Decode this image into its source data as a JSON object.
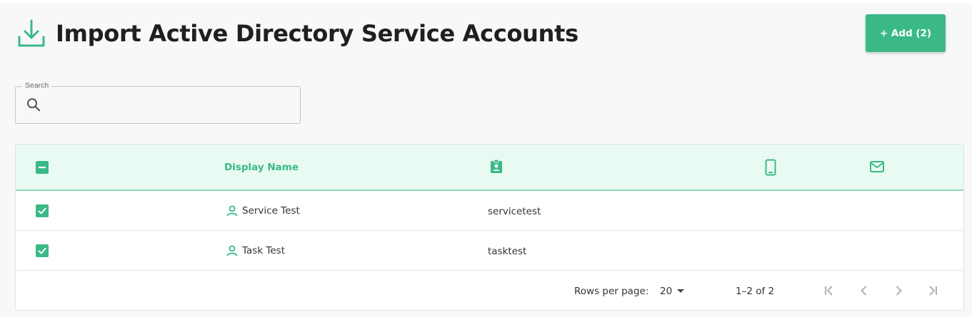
{
  "header": {
    "title": "Import Active Directory Service Accounts",
    "title_icon": "download-icon",
    "add_button_label": "+ Add (2)"
  },
  "search": {
    "label": "Search",
    "value": "",
    "icon": "search-icon"
  },
  "table": {
    "columns": [
      {
        "key": "select",
        "label": "",
        "icon": "select-all-indeterminate-checkbox"
      },
      {
        "key": "display_name",
        "label": "Display Name",
        "icon": ""
      },
      {
        "key": "account",
        "label": "",
        "icon": "badge-icon"
      },
      {
        "key": "phone",
        "label": "",
        "icon": "phone-icon"
      },
      {
        "key": "email",
        "label": "",
        "icon": "mail-icon"
      }
    ],
    "rows": [
      {
        "selected": true,
        "display_name": "Service Test",
        "account": "servicetest",
        "phone": "",
        "email": ""
      },
      {
        "selected": true,
        "display_name": "Task Test",
        "account": "tasktest",
        "phone": "",
        "email": ""
      }
    ]
  },
  "pagination": {
    "rows_per_page_label": "Rows per page:",
    "rows_per_page_value": "20",
    "range_text": "1–2 of 2"
  },
  "colors": {
    "accent": "#3ab987",
    "header_bg": "#e9faf2",
    "page_bg": "#f8f8f8"
  }
}
